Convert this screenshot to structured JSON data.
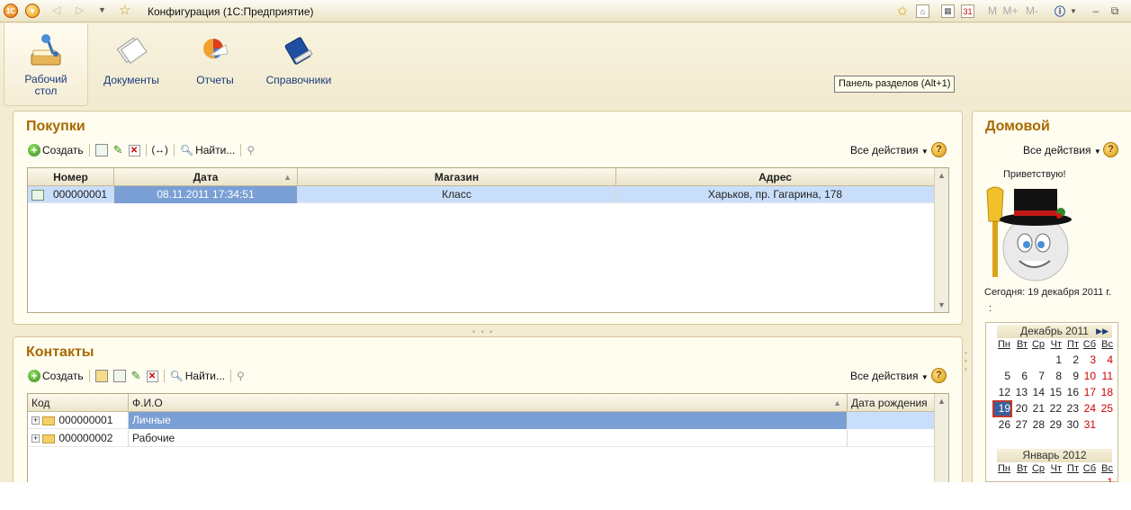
{
  "window": {
    "title": "Конфигурация  (1С:Предприятие)",
    "app_badge": "1С",
    "right_buttons": [
      "M",
      "M+",
      "M-"
    ]
  },
  "sections": {
    "items": [
      {
        "label_line1": "Рабочий",
        "label_line2": "стол",
        "icon": "desk-lamp-icon",
        "active": true
      },
      {
        "label": "Документы",
        "icon": "documents-icon"
      },
      {
        "label": "Отчеты",
        "icon": "reports-icon"
      },
      {
        "label": "Справочники",
        "icon": "book-icon"
      }
    ],
    "tooltip": "Панель разделов (Alt+1)"
  },
  "purchases": {
    "title": "Покупки",
    "toolbar": {
      "create": "Создать",
      "find": "Найти...",
      "all_actions": "Все действия",
      "help": "?"
    },
    "columns": [
      "Номер",
      "Дата",
      "Магазин",
      "Адрес"
    ],
    "rows": [
      {
        "number": "000000001",
        "date": "08.11.2011 17:34:51",
        "store": "Класс",
        "address": "Харьков, пр. Гагарина, 178"
      }
    ]
  },
  "contacts": {
    "title": "Контакты",
    "toolbar": {
      "create": "Создать",
      "find": "Найти...",
      "all_actions": "Все действия",
      "help": "?"
    },
    "columns": [
      "Код",
      "Ф.И.О",
      "Дата рождения"
    ],
    "rows": [
      {
        "code": "000000001",
        "name": "Личные",
        "birthdate": ""
      },
      {
        "code": "000000002",
        "name": "Рабочие",
        "birthdate": ""
      }
    ]
  },
  "side": {
    "title": "Домовой",
    "all_actions": "Все действия",
    "help": "?",
    "greeting": "Приветствую!",
    "today_label": "Сегодня:",
    "today_value": "19 декабря 2011 г.",
    "colon": ":"
  },
  "calendar": {
    "month1": "Декабрь 2011",
    "next_label": "▶▶",
    "weekdays": [
      "Пн",
      "Вт",
      "Ср",
      "Чт",
      "Пт",
      "Сб",
      "Вс"
    ],
    "weeks1": [
      [
        "",
        "",
        "",
        "1",
        "2",
        "3",
        "4"
      ],
      [
        "5",
        "6",
        "7",
        "8",
        "9",
        "10",
        "11"
      ],
      [
        "12",
        "13",
        "14",
        "15",
        "16",
        "17",
        "18"
      ],
      [
        "19",
        "20",
        "21",
        "22",
        "23",
        "24",
        "25"
      ],
      [
        "26",
        "27",
        "28",
        "29",
        "30",
        "31",
        ""
      ]
    ],
    "today": "19",
    "month2": "Январь 2012",
    "weeks2_first": [
      "",
      "",
      "",
      "",
      "",
      "",
      "1"
    ]
  },
  "colors": {
    "accent_title": "#a86a00",
    "selection": "#c9defa",
    "selection_dark": "#7a9fd4",
    "weekend": "#d10000"
  }
}
